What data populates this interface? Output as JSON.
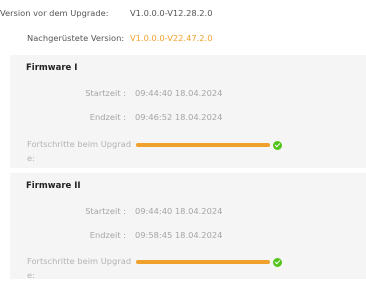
{
  "info": {
    "version_before_label": "Version vor dem Upgrade:",
    "version_before_value": "V1.0.0.0-V12.28.2.0",
    "retrofit_label": "Nachgerüstete Version:",
    "retrofit_value": "V1.0.0.0-V22.47.2.0",
    "accent_color": "#f0a12b"
  },
  "firmware": [
    {
      "title": "Firmware I",
      "start_label": "Startzeit :",
      "start_value": "09:44:40 18.04.2024",
      "end_label": "Endzeit :",
      "end_value": "09:46:52 18.04.2024",
      "progress_label": "Fortschritte beim Upgrade:",
      "progress": 1.0,
      "status_icon": "check-circle-icon"
    },
    {
      "title": "Firmware II",
      "start_label": "Startzeit :",
      "start_value": "09:44:40 18.04.2024",
      "end_label": "Endzeit :",
      "end_value": "09:58:45 18.04.2024",
      "progress_label": "Fortschritte beim Upgrade:",
      "progress": 1.0,
      "status_icon": "check-circle-icon"
    }
  ]
}
